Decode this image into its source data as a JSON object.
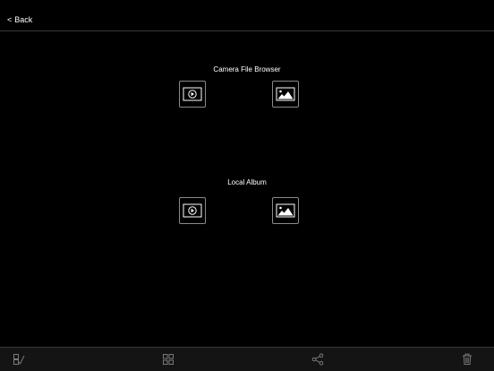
{
  "header": {
    "back_label": "Back",
    "back_icon": "chevron-left-icon"
  },
  "sections": [
    {
      "title": "Camera File Browser",
      "tiles": [
        {
          "kind": "video",
          "icon": "video-play-icon"
        },
        {
          "kind": "photo",
          "icon": "photo-landscape-icon"
        }
      ]
    },
    {
      "title": "Local Album",
      "tiles": [
        {
          "kind": "video",
          "icon": "video-play-icon"
        },
        {
          "kind": "photo",
          "icon": "photo-landscape-icon"
        }
      ]
    }
  ],
  "toolbar": {
    "items": [
      {
        "icon": "select-checkbox-icon"
      },
      {
        "icon": "grid-view-icon"
      },
      {
        "icon": "share-icon"
      },
      {
        "icon": "trash-icon"
      }
    ]
  },
  "colors": {
    "background": "#000000",
    "text": "#ffffff",
    "tile_border": "#8a8a8a",
    "toolbar_bg": "#141414",
    "toolbar_icon": "#7a7a7a"
  }
}
